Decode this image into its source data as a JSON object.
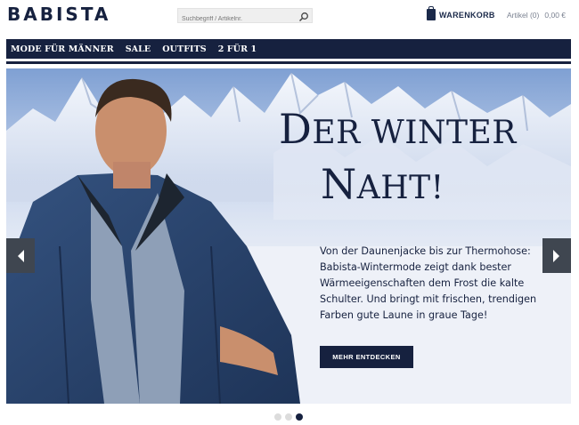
{
  "brand": {
    "logo": "BABISTA"
  },
  "search": {
    "placeholder": "Suchbegriff / Artikelnr.",
    "icon": "search-icon"
  },
  "cart": {
    "label": "WARENKORB",
    "items": "Artikel (0)",
    "total": "0,00 €"
  },
  "nav": {
    "items": [
      "MODE FÜR MÄNNER",
      "SALE",
      "OUTFITS",
      "2 FÜR 1"
    ]
  },
  "hero": {
    "headline_line1_cap": "D",
    "headline_line1_rest": "ER WINTER",
    "headline_line2_cap": "N",
    "headline_line2_rest": "AHT!",
    "text": "Von der Daunenjacke bis zur Thermohose: Babista-Wintermode zeigt dank bester Wärmeeigenschaften dem Frost die kalte Schulter. Und bringt mit frischen, trendigen Farben gute Laune in graue Tage!",
    "cta": "MEHR ENTDECKEN"
  },
  "carousel": {
    "slides": 3,
    "active_index": 2
  },
  "colors": {
    "navy": "#16213f",
    "arrow_bg": "#3f4650"
  }
}
